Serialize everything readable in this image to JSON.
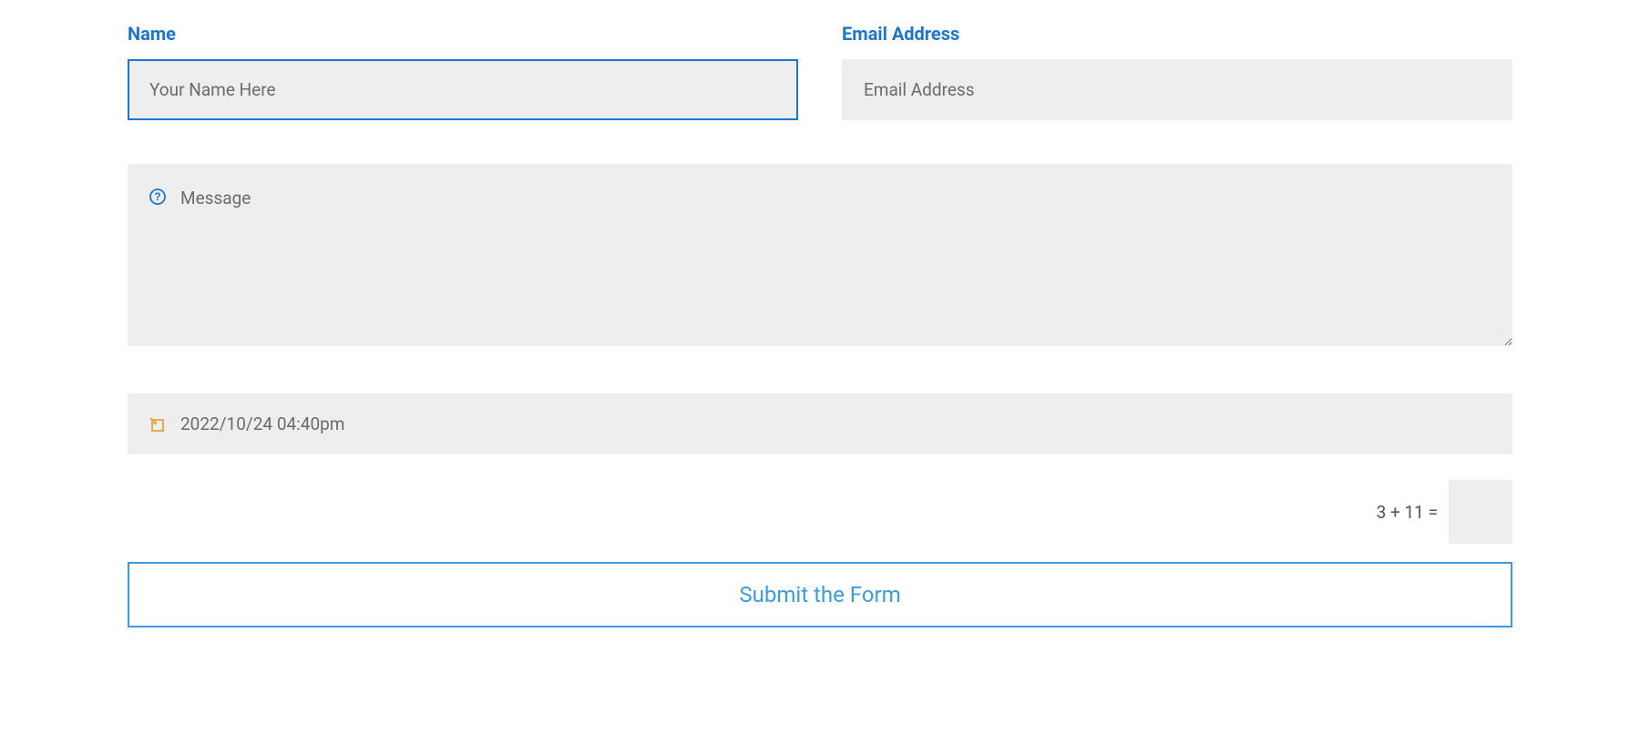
{
  "fields": {
    "name": {
      "label": "Name",
      "placeholder": "Your Name Here",
      "value": ""
    },
    "email": {
      "label": "Email Address",
      "placeholder": "Email Address",
      "value": ""
    },
    "message": {
      "placeholder": "Message",
      "value": ""
    },
    "datetime": {
      "value": "2022/10/24 04:40pm"
    }
  },
  "captcha": {
    "question": "3 + 11 =",
    "value": ""
  },
  "submit": {
    "label": "Submit the Form"
  }
}
